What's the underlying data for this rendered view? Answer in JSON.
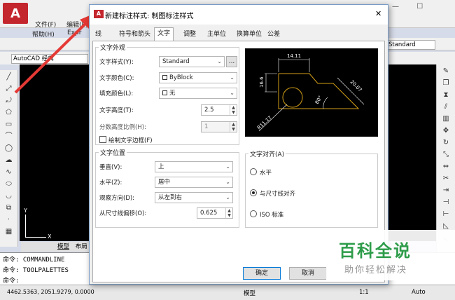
{
  "acad": {
    "menu": [
      "文件(F)",
      "编辑(E)",
      "帮助(H)",
      "Expr"
    ],
    "workspace": "AutoCAD 经典",
    "standard_right": "Standard",
    "cmd_lines": [
      "命令: COMMANDLINE",
      "命令: TOOLPALETTES",
      "命令:"
    ],
    "tabs": [
      "模型",
      "布局"
    ],
    "coords": "4462.5363, 2051.9279, 0.0000",
    "status_model": "模型",
    "scale": "1:1",
    "auto": "Auto"
  },
  "dialog": {
    "title": "新建标注样式: 制图标注样式",
    "close_glyph": "✕",
    "tabs": [
      "线",
      "符号和箭头",
      "文字",
      "调整",
      "主单位",
      "换算单位",
      "公差"
    ],
    "appearance": {
      "title": "文字外观",
      "style_label": "文字样式(Y):",
      "style_value": "Standard",
      "browse": "...",
      "color_label": "文字颜色(C):",
      "color_value": "ByBlock",
      "fill_label": "填充颜色(L):",
      "fill_value": "无",
      "height_label": "文字高度(T):",
      "height_value": "2.5",
      "frac_label": "分数高度比例(H):",
      "frac_value": "1",
      "frame_label": "绘制文字边框(F)"
    },
    "placement": {
      "title": "文字位置",
      "vertical_label": "垂直(V):",
      "vertical_value": "上",
      "horizontal_label": "水平(Z):",
      "horizontal_value": "居中",
      "view_label": "观察方向(D):",
      "view_value": "从左到右",
      "offset_label": "从尺寸线偏移(O):",
      "offset_value": "0.625"
    },
    "alignment": {
      "title": "文字对齐(A)",
      "options": [
        "水平",
        "与尺寸线对齐",
        "ISO 标准"
      ],
      "selected": 1
    },
    "preview": {
      "dim_top": "14.11",
      "dim_left": "16.6",
      "dim_right": "20.07",
      "angle": "80°",
      "radius": "R11.17"
    },
    "buttons": {
      "ok": "确定",
      "cancel": "取消"
    }
  },
  "watermark": {
    "title": "百科全说",
    "subtitle": "助你轻松解决"
  },
  "colors": {
    "accent": "#0078d7",
    "arrow": "#e53935",
    "watermark": "#2e9c4a",
    "preview_bg": "#000000"
  }
}
